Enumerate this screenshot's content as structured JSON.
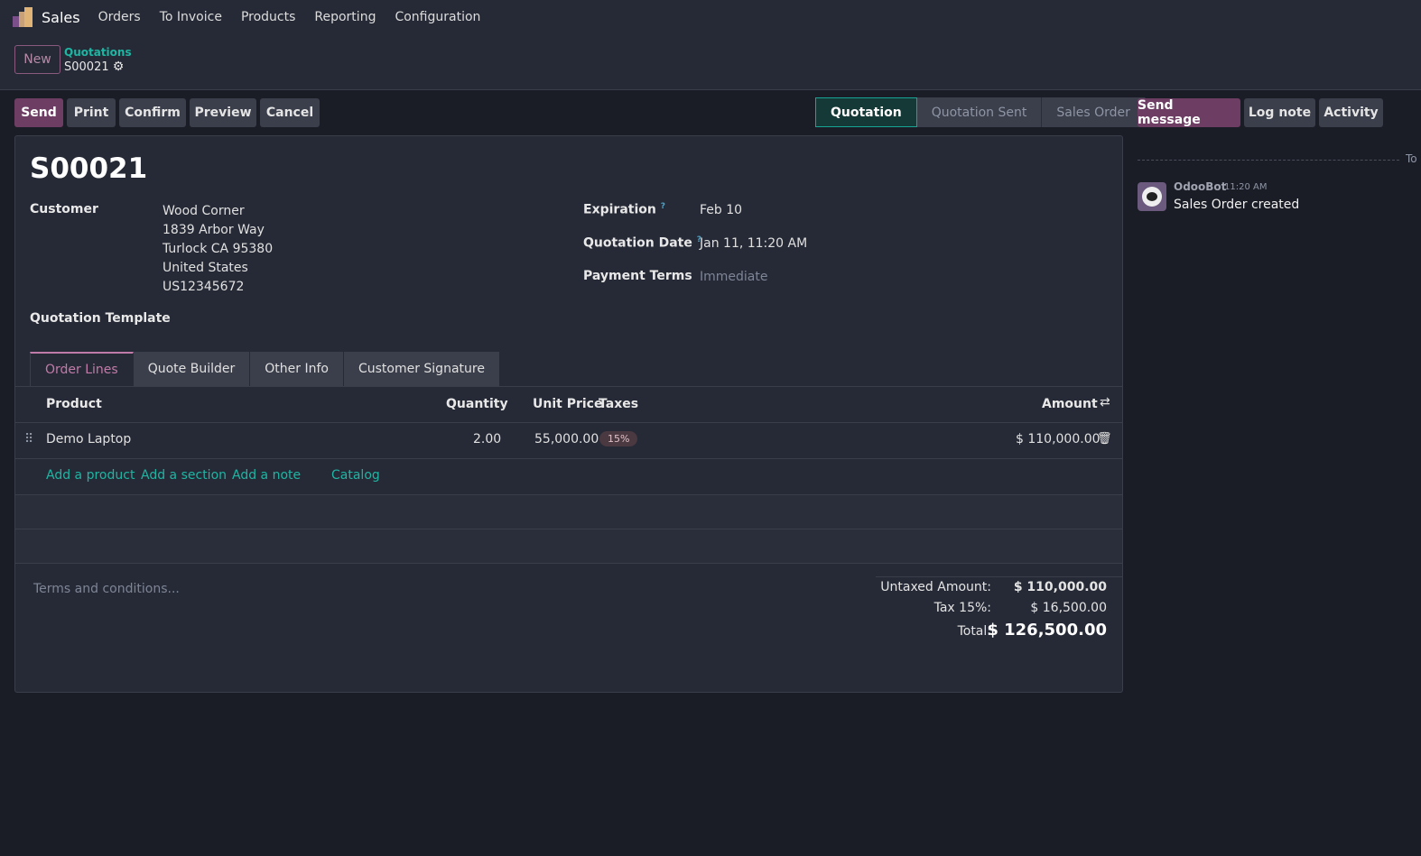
{
  "nav": {
    "app": "Sales",
    "menu": [
      "Orders",
      "To Invoice",
      "Products",
      "Reporting",
      "Configuration"
    ]
  },
  "control": {
    "new": "New",
    "breadcrumb": "Quotations",
    "record": "S00021"
  },
  "actions": [
    "Send",
    "Print",
    "Confirm",
    "Preview",
    "Cancel"
  ],
  "statusbar": {
    "stages": [
      "Quotation",
      "Quotation Sent",
      "Sales Order"
    ],
    "active": "Quotation"
  },
  "chatter": {
    "buttons": [
      "Send message",
      "Log note",
      "Activity"
    ],
    "date_sep": "To",
    "author": "OdooBot",
    "time": "11:20 AM",
    "message": "Sales Order created"
  },
  "form": {
    "title": "S00021",
    "customer_label": "Customer",
    "customer": [
      "Wood Corner",
      "1839 Arbor Way",
      "Turlock CA 95380",
      "United States",
      "US12345672"
    ],
    "expiration_label": "Expiration",
    "expiration": "Feb 10",
    "qdate_label": "Quotation Date",
    "qdate": "Jan 11, 11:20 AM",
    "terms_label": "Payment Terms",
    "terms": "Immediate",
    "template_label": "Quotation Template",
    "help": "?"
  },
  "tabs": [
    "Order Lines",
    "Quote Builder",
    "Other Info",
    "Customer Signature"
  ],
  "lines": {
    "headers": {
      "product": "Product",
      "qty": "Quantity",
      "price": "Unit Price",
      "taxes": "Taxes",
      "amount": "Amount"
    },
    "rows": [
      {
        "product": "Demo Laptop",
        "qty": "2.00",
        "price": "55,000.00",
        "tax": "15%",
        "amount": "$ 110,000.00"
      }
    ],
    "add": [
      "Add a product",
      "Add a section",
      "Add a note",
      "Catalog"
    ]
  },
  "footer": {
    "terms_placeholder": "Terms and conditions...",
    "untaxed_label": "Untaxed Amount:",
    "untaxed": "$ 110,000.00",
    "tax_label": "Tax 15%:",
    "tax": "$ 16,500.00",
    "total_label": "Total:",
    "total": "$ 126,500.00"
  },
  "colors": {
    "primary": "#6d3d64",
    "accent": "#1fb5a3"
  }
}
